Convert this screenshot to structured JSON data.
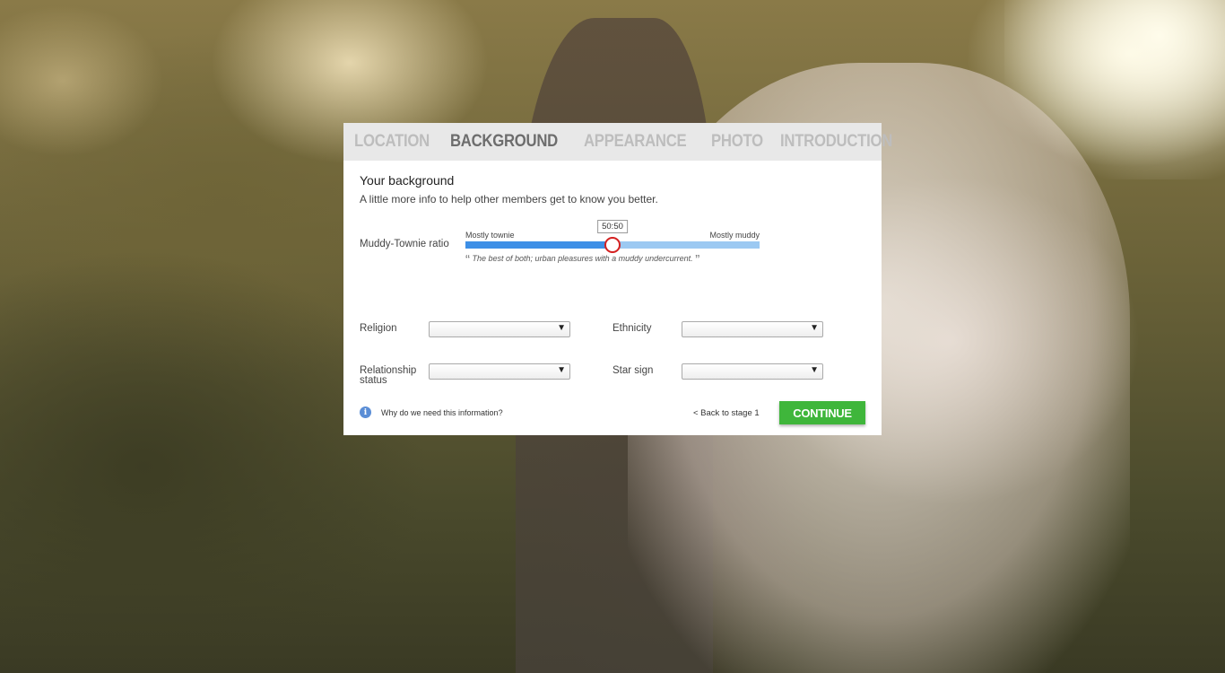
{
  "tabs": [
    {
      "label": "LOCATION",
      "active": false
    },
    {
      "label": "BACKGROUND",
      "active": true
    },
    {
      "label": "APPEARANCE",
      "active": false
    },
    {
      "label": "PHOTO",
      "active": false
    },
    {
      "label": "INTRODUCTION",
      "active": false
    }
  ],
  "form": {
    "heading": "Your background",
    "subheading": "A little more info to help other members get to know you better.",
    "ratio": {
      "label": "Muddy-Townie ratio",
      "left_label": "Mostly townie",
      "right_label": "Mostly muddy",
      "value_text": "50:50",
      "value_fraction": 0.5,
      "description": "The best of both; urban pleasures with a muddy undercurrent."
    },
    "religion": {
      "label": "Religion",
      "value": ""
    },
    "ethnicity": {
      "label": "Ethnicity",
      "value": ""
    },
    "relationship_status": {
      "label": "Relationship status",
      "value": ""
    },
    "star_sign": {
      "label": "Star sign",
      "value": ""
    }
  },
  "footer": {
    "info_link": "Why do we need this information?",
    "back_link": "< Back to stage 1",
    "continue_label": "CONTINUE"
  },
  "colors": {
    "accent_green": "#3fb63b",
    "slider_fill": "#3d8fe6",
    "slider_track": "#9cc9f2",
    "slider_thumb_border": "#d42020",
    "active_tab": "#6d6d6d",
    "inactive_tab": "#bdbdbd"
  },
  "icons": {
    "info": "info-icon",
    "dropdown": "chevron-down-icon"
  }
}
